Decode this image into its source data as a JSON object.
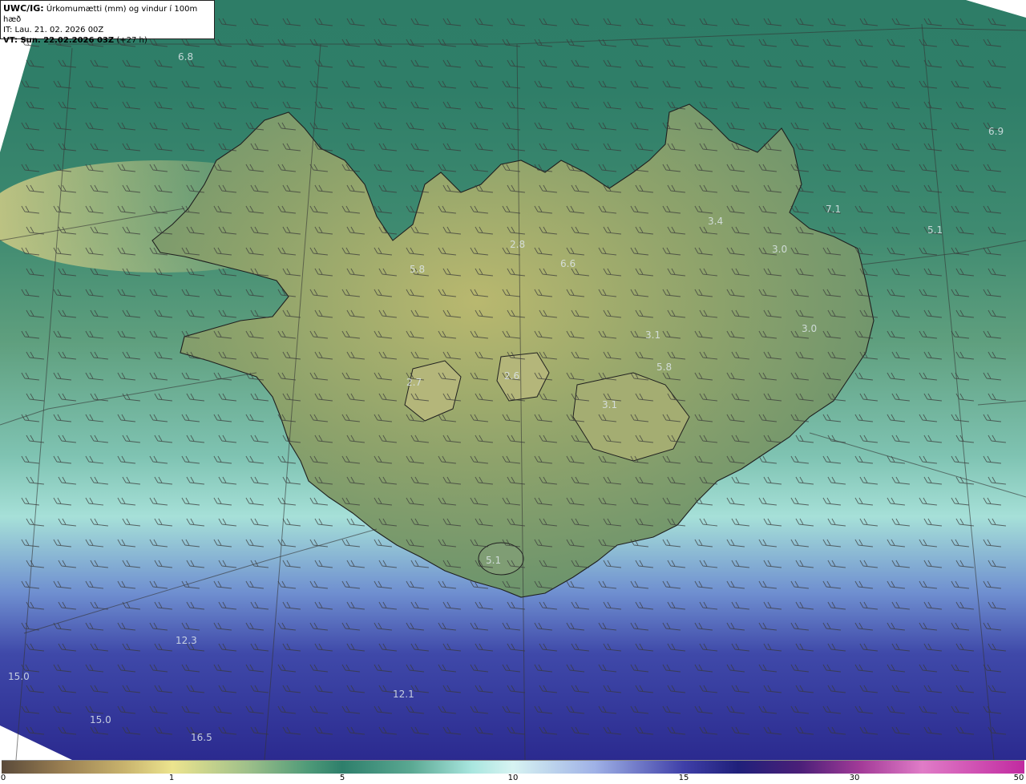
{
  "header": {
    "title_bold": "UWC/IG:",
    "title_rest": "Úrkomumætti (mm) og vindur í 100m hæð",
    "it_line": "IT: Lau. 21. 02. 2026 00Z",
    "vt_bold": "VT: Sun. 22.02.2026 03Z",
    "vt_rest": "(+27 h)"
  },
  "map_values": [
    {
      "id": "v1",
      "text": "6.8"
    },
    {
      "id": "v2",
      "text": "6.9"
    },
    {
      "id": "v3",
      "text": "7.1"
    },
    {
      "id": "v4",
      "text": "5.1"
    },
    {
      "id": "v5",
      "text": "3.4"
    },
    {
      "id": "v6",
      "text": "3.0"
    },
    {
      "id": "v7",
      "text": "3.0"
    },
    {
      "id": "v8",
      "text": "5.8"
    },
    {
      "id": "v9",
      "text": "6.6"
    },
    {
      "id": "v10",
      "text": "2.8"
    },
    {
      "id": "v11",
      "text": "3.1"
    },
    {
      "id": "v12",
      "text": "5.8"
    },
    {
      "id": "v13",
      "text": "2.6"
    },
    {
      "id": "v14",
      "text": "2.7"
    },
    {
      "id": "v15",
      "text": "3.1"
    },
    {
      "id": "v16",
      "text": "5.1"
    },
    {
      "id": "v17",
      "text": "12.3"
    },
    {
      "id": "v18",
      "text": "15.0"
    },
    {
      "id": "v19",
      "text": "15.0"
    },
    {
      "id": "v20",
      "text": "12.1"
    },
    {
      "id": "v21",
      "text": "16.5"
    }
  ],
  "colorbar": {
    "ticks": [
      "0",
      "1",
      "5",
      "10",
      "15",
      "30",
      "50"
    ]
  }
}
